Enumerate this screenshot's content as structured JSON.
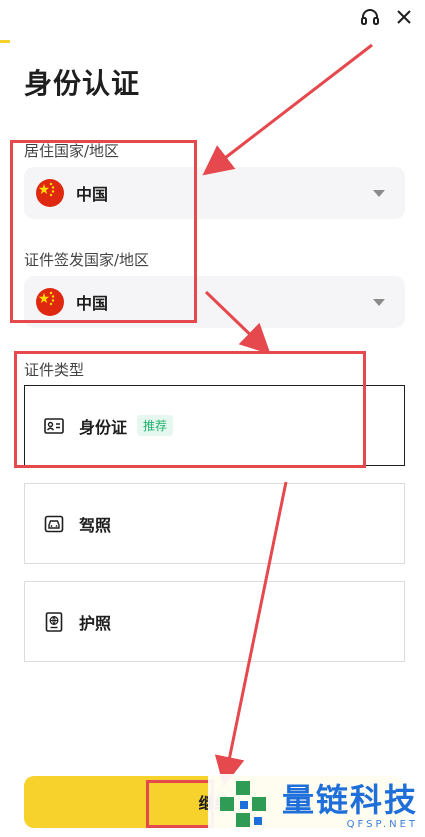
{
  "header": {
    "support_icon": "headset-icon",
    "close_icon": "close-icon"
  },
  "page": {
    "title": "身份认证"
  },
  "residence": {
    "label": "居住国家/地区",
    "value": "中国",
    "flag": "china-flag-icon"
  },
  "issuing": {
    "label": "证件签发国家/地区",
    "value": "中国",
    "flag": "china-flag-icon"
  },
  "doc_type": {
    "label": "证件类型",
    "options": [
      {
        "label": "身份证",
        "badge": "推荐",
        "icon": "id-card-icon",
        "selected": true
      },
      {
        "label": "驾照",
        "icon": "car-icon",
        "selected": false
      },
      {
        "label": "护照",
        "icon": "passport-icon",
        "selected": false
      }
    ]
  },
  "footer": {
    "button_label": "继续"
  },
  "watermark": {
    "title": "量链科技",
    "subtitle": "QFSP.NET"
  },
  "colors": {
    "accent": "#f7d22d",
    "annotation": "#e5484d",
    "badge_text": "#20b26c",
    "watermark": "#1e6fd9"
  }
}
